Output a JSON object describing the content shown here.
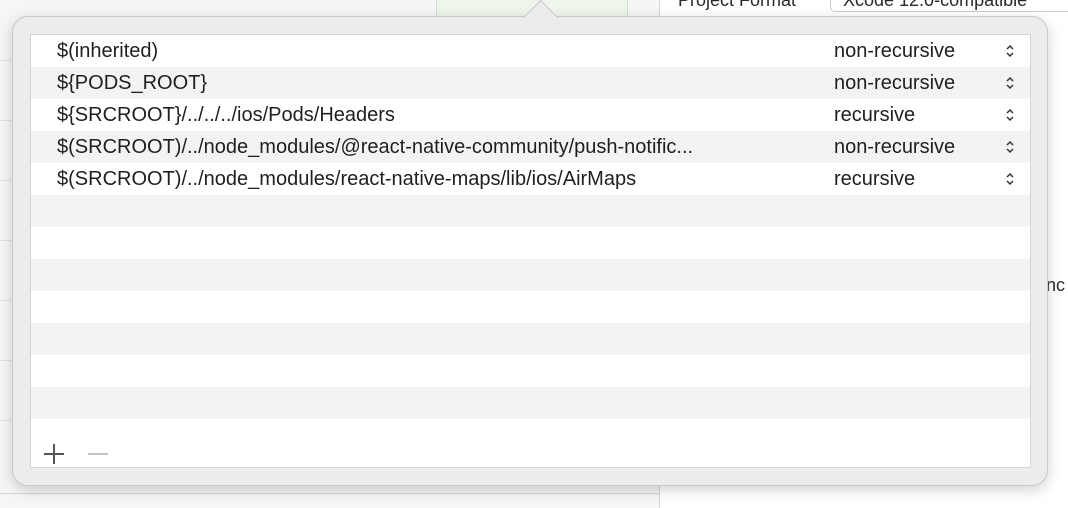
{
  "background": {
    "label": "Project Format",
    "popup_value": "Xcode 12.0-compatible",
    "right_fragment": "nc"
  },
  "popover": {
    "rows": [
      {
        "path": "$(inherited)",
        "mode": "non-recursive"
      },
      {
        "path": "${PODS_ROOT}",
        "mode": "non-recursive"
      },
      {
        "path": "${SRCROOT}/../../../ios/Pods/Headers",
        "mode": "recursive"
      },
      {
        "path": "$(SRCROOT)/../node_modules/@react-native-community/push-notific...",
        "mode": "non-recursive"
      },
      {
        "path": "$(SRCROOT)/../node_modules/react-native-maps/lib/ios/AirMaps",
        "mode": "recursive"
      }
    ],
    "empty_row_count": 7,
    "footer": {
      "add_icon": "plus-icon",
      "remove_icon": "minus-icon"
    }
  }
}
